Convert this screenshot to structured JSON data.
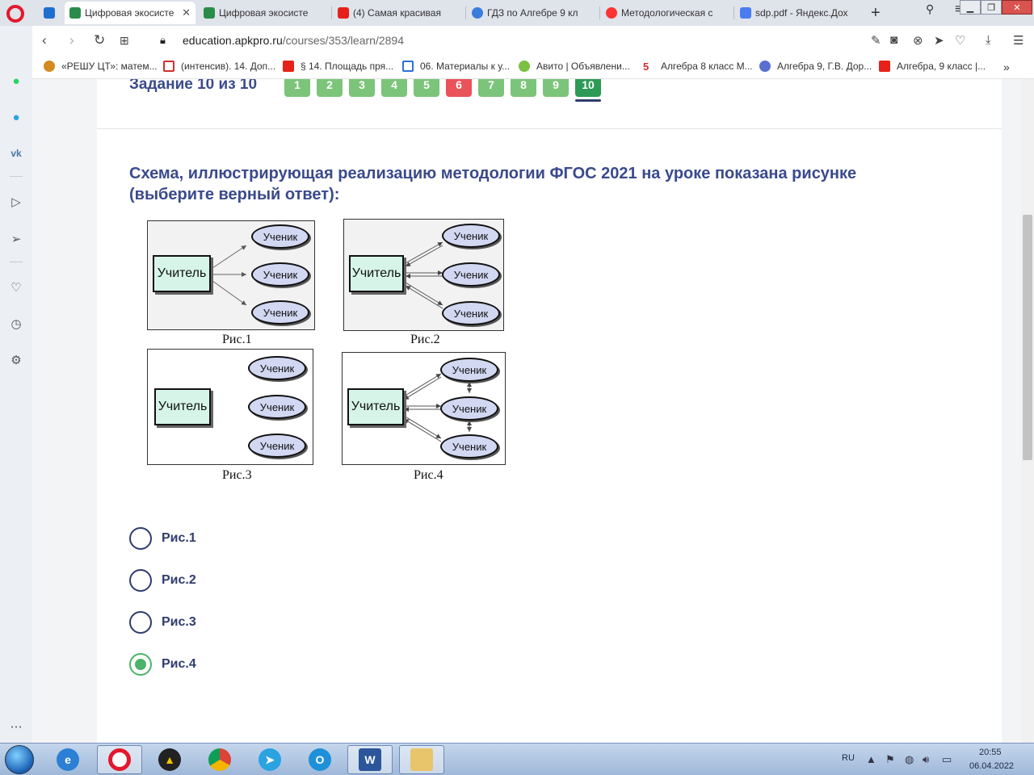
{
  "browser": {
    "tabs": [
      {
        "label": "Цифровая экосисте",
        "active": true,
        "favicon_color": "#2a8c4a"
      },
      {
        "label": "Цифровая экосисте",
        "active": false,
        "favicon_color": "#2a8c4a"
      },
      {
        "label": "(4) Самая красивая",
        "active": false,
        "favicon_color": "#e62117"
      },
      {
        "label": "ГДЗ по Алгебре 9 кл",
        "active": false,
        "favicon_color": "#3b7ddd"
      },
      {
        "label": "Методологическая с",
        "active": false,
        "favicon_color": "#f33"
      },
      {
        "label": "sdp.pdf - Яндекс.Дох",
        "active": false,
        "favicon_color": "#4a7cf0"
      }
    ],
    "url_host": "education.apkpro.ru",
    "url_path": "/courses/353/learn/2894",
    "bookmarks": [
      {
        "label": "«РЕШУ ЦТ»: матем...",
        "icon_color": "#d48a1e"
      },
      {
        "label": "(интенсив). 14. Доп...",
        "icon_color": "#d32f2f"
      },
      {
        "label": "§ 14. Площадь пря...",
        "icon_color": "#e62117"
      },
      {
        "label": "06. Материалы к у...",
        "icon_color": "#2f6fd6"
      },
      {
        "label": "Авито | Объявлени...",
        "icon_color": "#7bc043"
      },
      {
        "label": "Алгебра 8 класс М...",
        "icon_color": "#d32f2f"
      },
      {
        "label": "Алгебра 9, Г.В. Дор...",
        "icon_color": "#5a6fd0"
      },
      {
        "label": "Алгебра, 9 класс |...",
        "icon_color": "#e62117"
      }
    ]
  },
  "task": {
    "title": "Задание 10 из 10",
    "numbers": [
      "1",
      "2",
      "3",
      "4",
      "5",
      "6",
      "7",
      "8",
      "9",
      "10"
    ],
    "wrong_index": 5,
    "current_index": 9,
    "question": "Схема, иллюстрирующая реализацию методологии ФГОС 2021 на уроке показана рисунке (выберите верный ответ):"
  },
  "figures": {
    "teacher_label": "Учитель",
    "student_label": "Ученик",
    "captions": [
      "Рис.1",
      "Рис.2",
      "Рис.3",
      "Рис.4"
    ]
  },
  "options": [
    {
      "label": "Рис.1",
      "checked": false
    },
    {
      "label": "Рис.2",
      "checked": false
    },
    {
      "label": "Рис.3",
      "checked": false
    },
    {
      "label": "Рис.4",
      "checked": true
    }
  ],
  "taskbar": {
    "language": "RU",
    "time": "20:55",
    "date": "06.04.2022"
  },
  "colors": {
    "accent_blue": "#3a4a8c",
    "correct_green": "#4cb46a",
    "wrong_red": "#e9545a"
  }
}
